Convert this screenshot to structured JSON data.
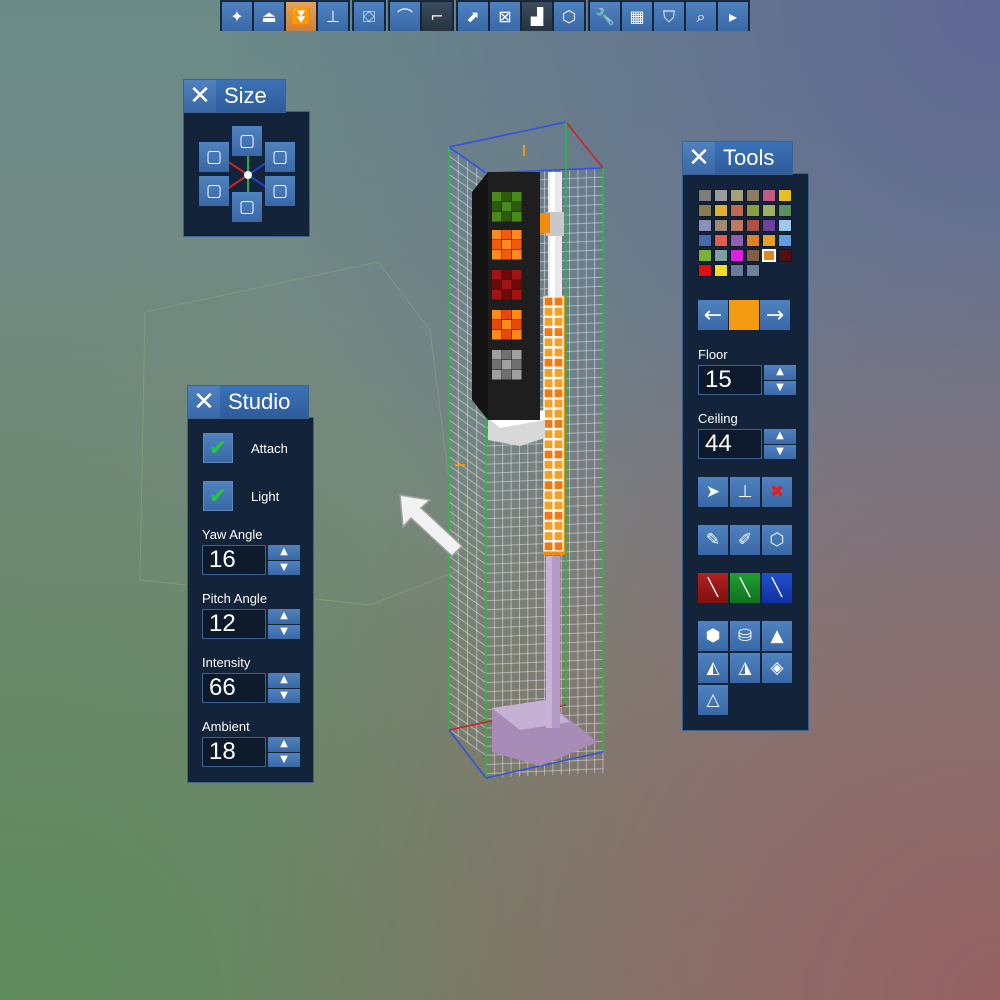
{
  "toolbar": {
    "groups": [
      [
        {
          "name": "star-icon",
          "glyph": "✦"
        },
        {
          "name": "raise-face-icon",
          "glyph": "⏏"
        },
        {
          "name": "lower-face-icon",
          "glyph": "⏬",
          "active": true
        },
        {
          "name": "flatten-icon",
          "glyph": "⊥"
        }
      ],
      [
        {
          "name": "cube-stack-icon",
          "glyph": "⛋"
        }
      ],
      [
        {
          "name": "ramp-up-icon",
          "glyph": "⌒"
        },
        {
          "name": "ramp-down-icon",
          "glyph": "⌐",
          "dark": true
        }
      ],
      [
        {
          "name": "stairs-icon",
          "glyph": "⬈"
        },
        {
          "name": "cross-stairs-icon",
          "glyph": "⊠"
        },
        {
          "name": "step-block-icon",
          "glyph": "▟",
          "dark": true
        },
        {
          "name": "wire-cube-icon",
          "glyph": "⬡"
        }
      ],
      [
        {
          "name": "wrench-icon",
          "glyph": "🔧"
        },
        {
          "name": "grid-icon",
          "glyph": "▦"
        },
        {
          "name": "paint-bucket-icon",
          "glyph": "⛉"
        },
        {
          "name": "zoom-icon",
          "glyph": "⌕"
        },
        {
          "name": "play-icon",
          "glyph": "▸"
        }
      ]
    ]
  },
  "size_panel": {
    "title": "Size"
  },
  "studio_panel": {
    "title": "Studio",
    "toggles": [
      {
        "key": "attach",
        "label": "Attach",
        "checked": true
      },
      {
        "key": "light",
        "label": "Light",
        "checked": true
      }
    ],
    "fields": [
      {
        "key": "yaw",
        "label": "Yaw Angle",
        "value": "16"
      },
      {
        "key": "pitch",
        "label": "Pitch Angle",
        "value": "12"
      },
      {
        "key": "intensity",
        "label": "Intensity",
        "value": "66"
      },
      {
        "key": "ambient",
        "label": "Ambient",
        "value": "18"
      }
    ]
  },
  "tools_panel": {
    "title": "Tools",
    "palette": [
      "#7d7d7d",
      "#9b9b9b",
      "#a3a07a",
      "#8c7d5e",
      "#c35a86",
      "#e8c020",
      "#8c7a52",
      "#e0b030",
      "#c06850",
      "#8aa040",
      "#a0b060",
      "#5a9060",
      "#8a90b8",
      "#a08a70",
      "#c07860",
      "#b05040",
      "#6a40a0",
      "#a0c8e8",
      "#4a6ab0",
      "#e06050",
      "#9060b0",
      "#e08020",
      "#e8a020",
      "#60a0e0",
      "#80b030",
      "#80a0a0",
      "#e020e0",
      "#806040",
      "#e08820",
      "#501010",
      "#e01010",
      "#f0e020",
      "#6a7a9a",
      "#70809a"
    ],
    "selected_index": 28,
    "current_color": "#f39a10",
    "floor": {
      "label": "Floor",
      "value": "15"
    },
    "ceiling": {
      "label": "Ceiling",
      "value": "44"
    }
  }
}
